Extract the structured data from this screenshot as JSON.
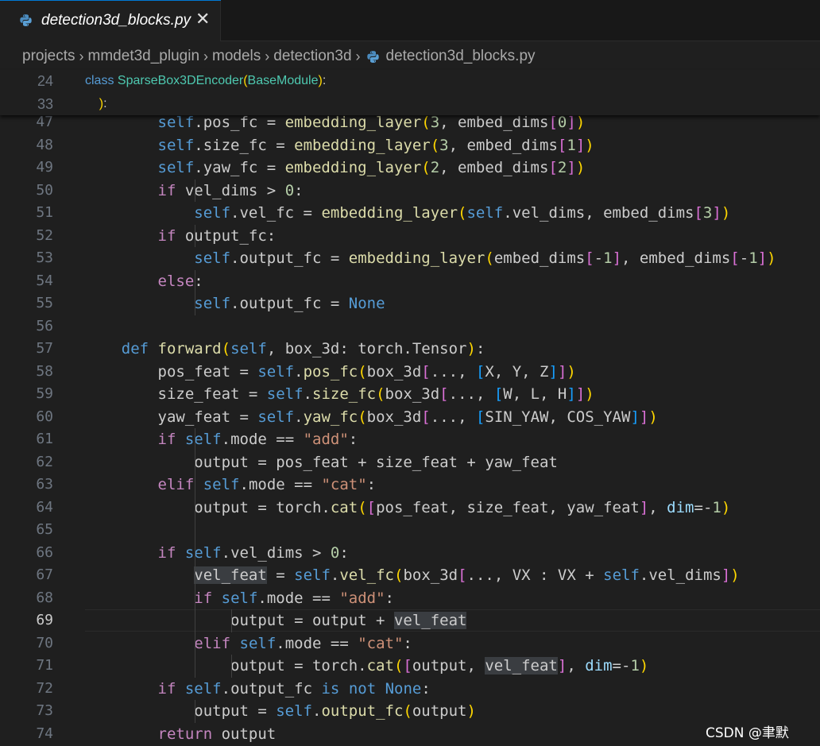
{
  "tab": {
    "label": "detection3d_blocks.py",
    "close": "✕",
    "icon": "python-file-icon"
  },
  "breadcrumb": {
    "items": [
      "projects",
      "mmdet3d_plugin",
      "models",
      "detection3d",
      "detection3d_blocks.py"
    ],
    "separator": "›"
  },
  "sticky": [
    {
      "num": "24",
      "code": "class SparseBox3DEncoder(BaseModule):"
    },
    {
      "num": "33",
      "code": "    ):"
    }
  ],
  "lines": [
    {
      "num": "47",
      "code": "        self.pos_fc = embedding_layer(3, embed_dims[0])"
    },
    {
      "num": "48",
      "code": "        self.size_fc = embedding_layer(3, embed_dims[1])"
    },
    {
      "num": "49",
      "code": "        self.yaw_fc = embedding_layer(2, embed_dims[2])"
    },
    {
      "num": "50",
      "code": "        if vel_dims > 0:"
    },
    {
      "num": "51",
      "code": "            self.vel_fc = embedding_layer(self.vel_dims, embed_dims[3])"
    },
    {
      "num": "52",
      "code": "        if output_fc:"
    },
    {
      "num": "53",
      "code": "            self.output_fc = embedding_layer(embed_dims[-1], embed_dims[-1])"
    },
    {
      "num": "54",
      "code": "        else:"
    },
    {
      "num": "55",
      "code": "            self.output_fc = None"
    },
    {
      "num": "56",
      "code": ""
    },
    {
      "num": "57",
      "code": "    def forward(self, box_3d: torch.Tensor):"
    },
    {
      "num": "58",
      "code": "        pos_feat = self.pos_fc(box_3d[..., [X, Y, Z]])"
    },
    {
      "num": "59",
      "code": "        size_feat = self.size_fc(box_3d[..., [W, L, H]])"
    },
    {
      "num": "60",
      "code": "        yaw_feat = self.yaw_fc(box_3d[..., [SIN_YAW, COS_YAW]])"
    },
    {
      "num": "61",
      "code": "        if self.mode == \"add\":"
    },
    {
      "num": "62",
      "code": "            output = pos_feat + size_feat + yaw_feat"
    },
    {
      "num": "63",
      "code": "        elif self.mode == \"cat\":"
    },
    {
      "num": "64",
      "code": "            output = torch.cat([pos_feat, size_feat, yaw_feat], dim=-1)"
    },
    {
      "num": "65",
      "code": ""
    },
    {
      "num": "66",
      "code": "        if self.vel_dims > 0:"
    },
    {
      "num": "67",
      "code": "            vel_feat = self.vel_fc(box_3d[..., VX : VX + self.vel_dims])"
    },
    {
      "num": "68",
      "code": "            if self.mode == \"add\":"
    },
    {
      "num": "69",
      "code": "                output = output + vel_feat"
    },
    {
      "num": "70",
      "code": "            elif self.mode == \"cat\":"
    },
    {
      "num": "71",
      "code": "                output = torch.cat([output, vel_feat], dim=-1)"
    },
    {
      "num": "72",
      "code": "        if self.output_fc is not None:"
    },
    {
      "num": "73",
      "code": "            output = self.output_fc(output)"
    },
    {
      "num": "74",
      "code": "        return output"
    }
  ],
  "active_line": "69",
  "watermark": "CSDN @聿默",
  "colors": {
    "background": "#1f1f1f",
    "keyword": "#569cd6",
    "control": "#c586c0",
    "class": "#4ec9b0",
    "function": "#dcdcaa",
    "variable": "#9cdcfe",
    "string": "#ce9178",
    "number": "#b5cea8"
  }
}
